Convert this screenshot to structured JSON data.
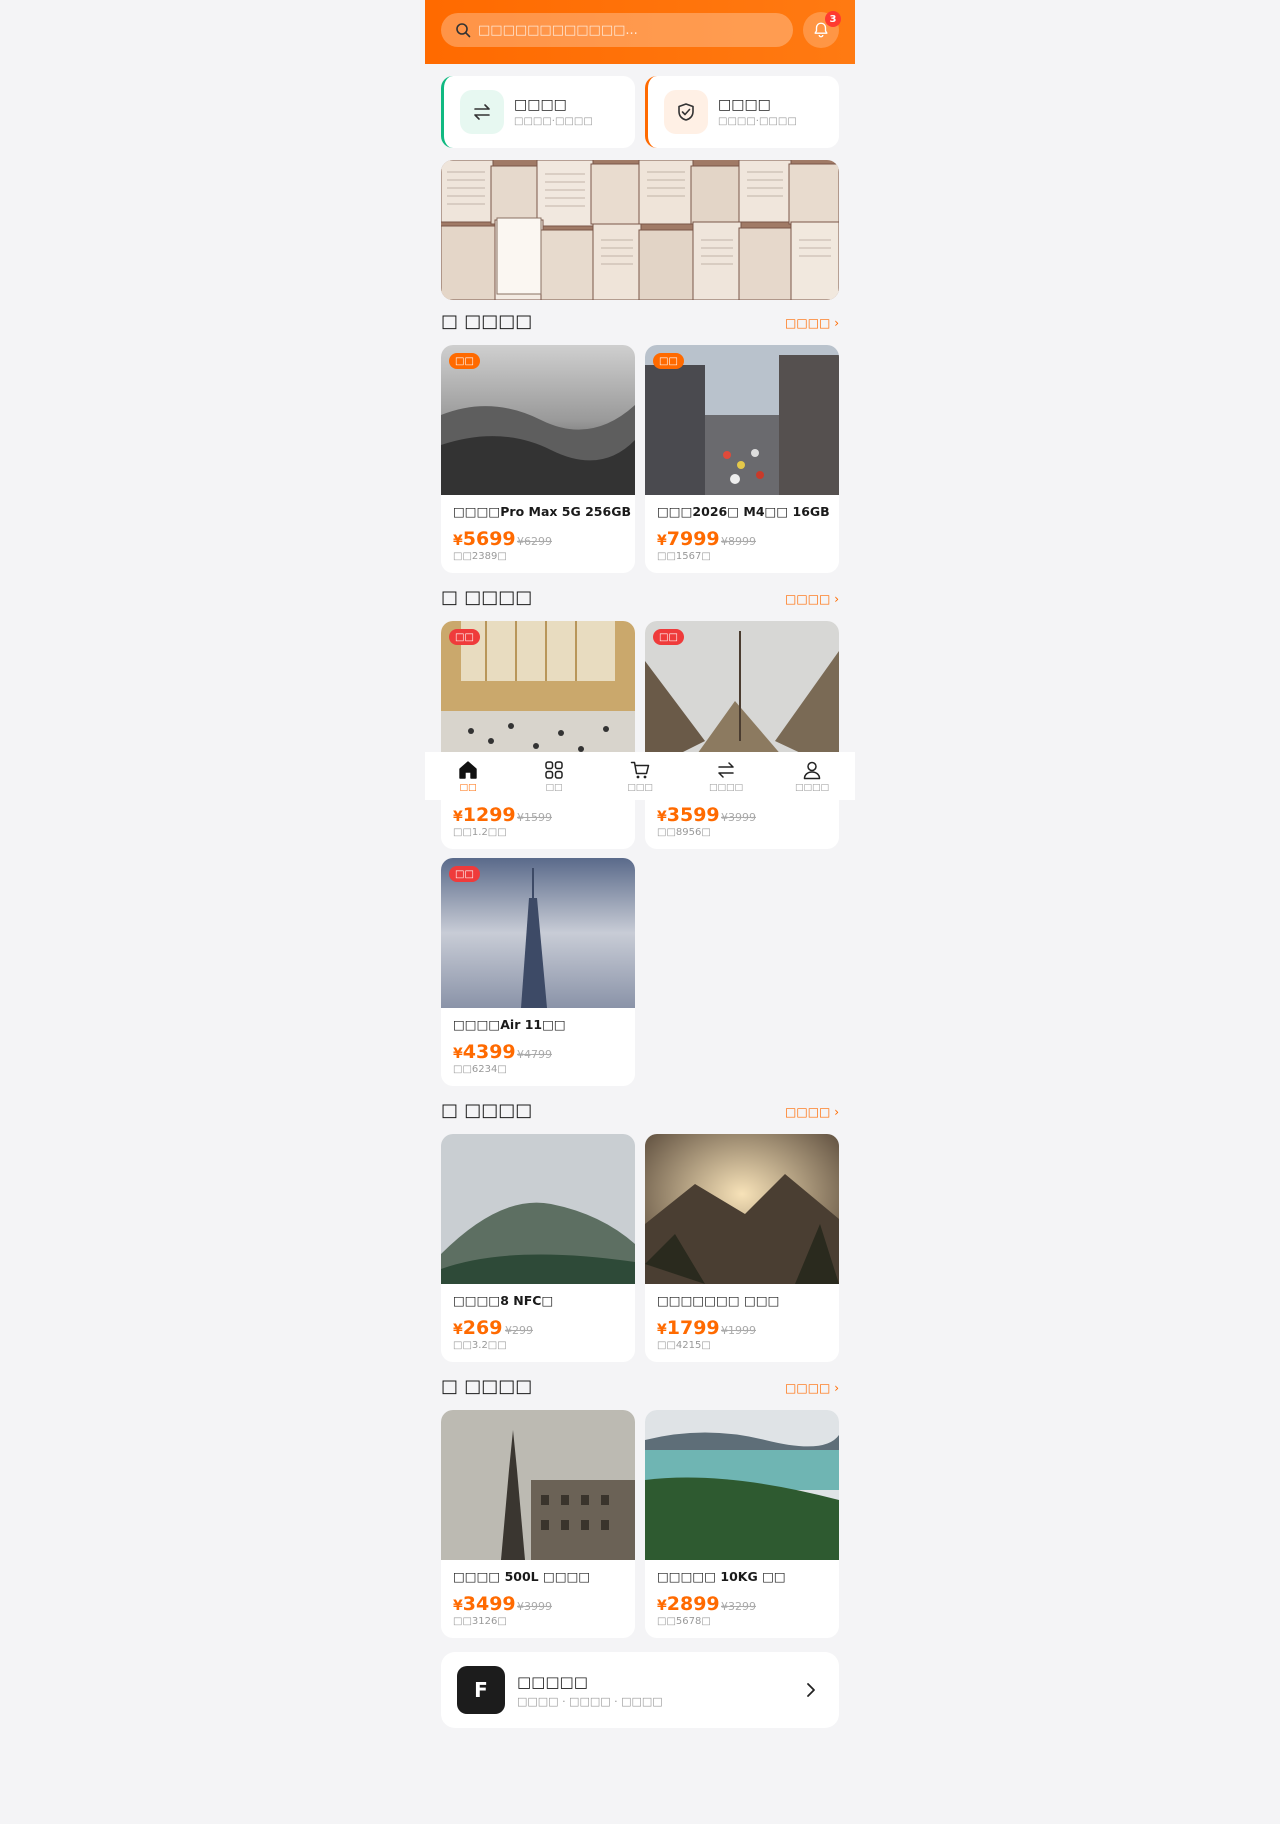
{
  "header": {
    "search_placeholder": "□□□□□□□□□□□□...",
    "notification_count": "3"
  },
  "quick_cards": [
    {
      "title": "□□□□",
      "sub": "□□□□·□□□□",
      "icon": "swap-icon",
      "accent": "#10b981"
    },
    {
      "title": "□□□□",
      "sub": "□□□□·□□□□",
      "icon": "shield-check-icon",
      "accent": "#ff6a00"
    }
  ],
  "banner": {
    "alt": "books-banner"
  },
  "sections": [
    {
      "title": "□ □□□□",
      "more": "□□□□ ›",
      "products": [
        {
          "tag": "□□",
          "tag_color": "orange",
          "name": "□□□□Pro Max 5G 256GB",
          "currency": "¥",
          "price": "5699",
          "original": "¥6299",
          "sold": "□□2389□"
        },
        {
          "tag": "□□",
          "tag_color": "orange",
          "name": "□□□2026□ M4□□ 16GB",
          "currency": "¥",
          "price": "7999",
          "original": "¥8999",
          "sold": "□□1567□"
        }
      ]
    },
    {
      "title": "□ □□□□",
      "more": "□□□□ ›",
      "products": [
        {
          "tag": "□□",
          "tag_color": "red",
          "name": "",
          "currency": "¥",
          "price": "1299",
          "original": "¥1599",
          "sold": "□□1.2□□"
        },
        {
          "tag": "□□",
          "tag_color": "red",
          "name": "",
          "currency": "¥",
          "price": "3599",
          "original": "¥3999",
          "sold": "□□8956□"
        },
        {
          "tag": "□□",
          "tag_color": "red",
          "name": "□□□□Air 11□□",
          "currency": "¥",
          "price": "4399",
          "original": "¥4799",
          "sold": "□□6234□"
        }
      ]
    },
    {
      "title": "□ □□□□",
      "more": "□□□□ ›",
      "products": [
        {
          "tag": "",
          "name": "□□□□8 NFC□",
          "currency": "¥",
          "price": "269",
          "original": "¥299",
          "sold": "□□3.2□□"
        },
        {
          "tag": "",
          "name": "□□□□□□□ □□□",
          "currency": "¥",
          "price": "1799",
          "original": "¥1999",
          "sold": "□□4215□"
        }
      ]
    },
    {
      "title": "□ □□□□",
      "more": "□□□□ ›",
      "products": [
        {
          "tag": "",
          "name": "□□□□ 500L □□□□",
          "currency": "¥",
          "price": "3499",
          "original": "¥3999",
          "sold": "□□3126□"
        },
        {
          "tag": "",
          "name": "□□□□□ 10KG □□",
          "currency": "¥",
          "price": "2899",
          "original": "¥3299",
          "sold": "□□5678□"
        }
      ]
    }
  ],
  "bottom_nav": [
    {
      "label": "□□",
      "icon": "home-icon",
      "active": true
    },
    {
      "label": "□□",
      "icon": "grid-icon",
      "active": false
    },
    {
      "label": "□□□",
      "icon": "cart-icon",
      "active": false
    },
    {
      "label": "□□□□",
      "icon": "swap-icon",
      "active": false
    },
    {
      "label": "□□□□",
      "icon": "user-icon",
      "active": false
    }
  ],
  "footer": {
    "logo_letter": "F",
    "title": "□□□□□",
    "sub": "□□□□ · □□□□ · □□□□"
  },
  "colors": {
    "brand": "#ff6a00",
    "sale_tag": "#ef3b3b",
    "green": "#10b981"
  }
}
